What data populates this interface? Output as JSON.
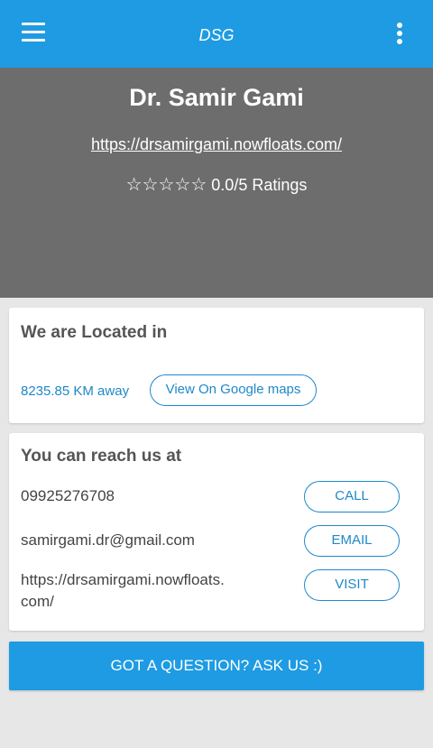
{
  "appbar": {
    "title": "DSG",
    "menu_icon": "hamburger-menu-icon",
    "more_icon": "more-vertical-icon",
    "color": "#1e9be3"
  },
  "hero": {
    "name": "Dr. Samir Gami",
    "url": "https://drsamirgami.nowfloats.com/",
    "stars": "☆☆☆☆☆",
    "rating_text": "0.0/5 Ratings",
    "rating_value": 0.0,
    "rating_max": 5
  },
  "location": {
    "title": "We are Located in",
    "distance": "8235.85 KM away",
    "maps_label": "View On Google maps"
  },
  "reach": {
    "title": "You can reach us at",
    "phone": "09925276708",
    "call_label": "CALL",
    "email": "samirgami.dr@gmail.com",
    "email_label": "EMAIL",
    "website_line1": "https://drsamirgami.nowfloats.",
    "website_line2": "com/",
    "visit_label": "VISIT"
  },
  "cta": {
    "label": "GOT A QUESTION? ASK US :)"
  }
}
